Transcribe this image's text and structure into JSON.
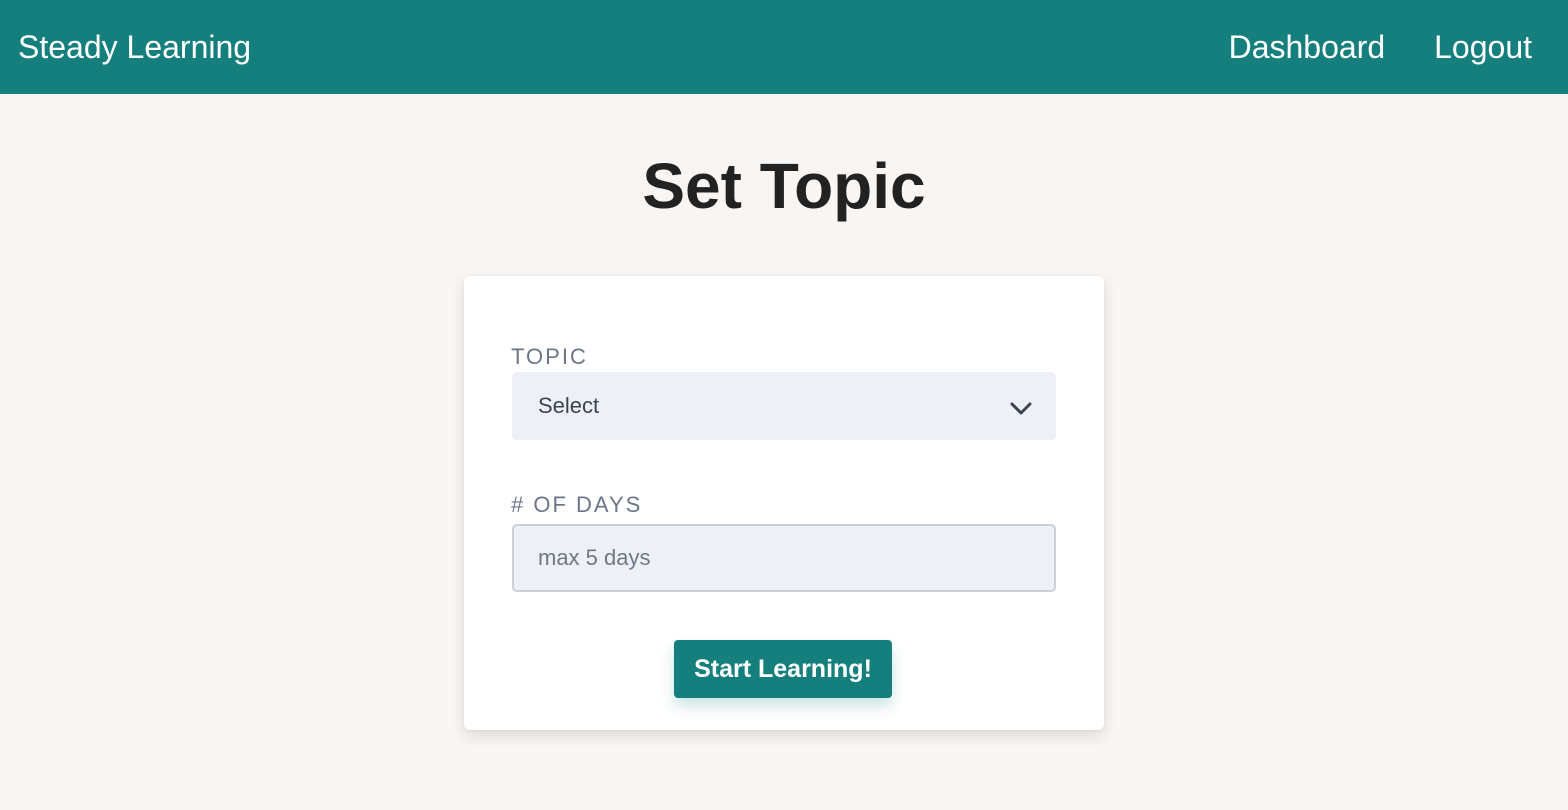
{
  "nav": {
    "brand": "Steady Learning",
    "links": [
      {
        "label": "Dashboard"
      },
      {
        "label": "Logout"
      }
    ]
  },
  "main": {
    "title": "Set Topic"
  },
  "form": {
    "topic": {
      "label": "TOPIC",
      "selected": "Select",
      "icon": "chevron-down-icon"
    },
    "days": {
      "label": "# OF DAYS",
      "value": "",
      "placeholder": "max 5 days"
    },
    "submit_label": "Start Learning!"
  },
  "colors": {
    "brand": "#157f7e",
    "background": "#f8f5f3",
    "input_bg": "#edf1f7",
    "label": "#6b7788"
  }
}
